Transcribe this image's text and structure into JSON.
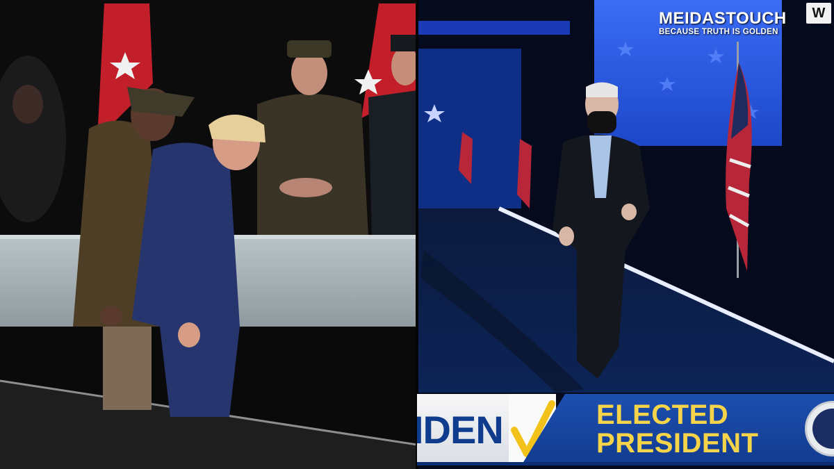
{
  "watermark": {
    "title": "MEIDASTOUCH",
    "subtitle": "BECAUSE TRUTH IS GOLDEN",
    "corner_badge": "W"
  },
  "chyron": {
    "name_fragment": "IDEN",
    "headline_line1": "ELECTED",
    "headline_line2": "PRESIDENT",
    "check_icon": "check-icon",
    "seal_icon": "presidential-seal-icon"
  },
  "colors": {
    "chyron_blue": "#1c4fb0",
    "chyron_gold": "#f6d44a",
    "name_blue": "#0f3c8d",
    "stage_blue": "#2a5fe0"
  }
}
